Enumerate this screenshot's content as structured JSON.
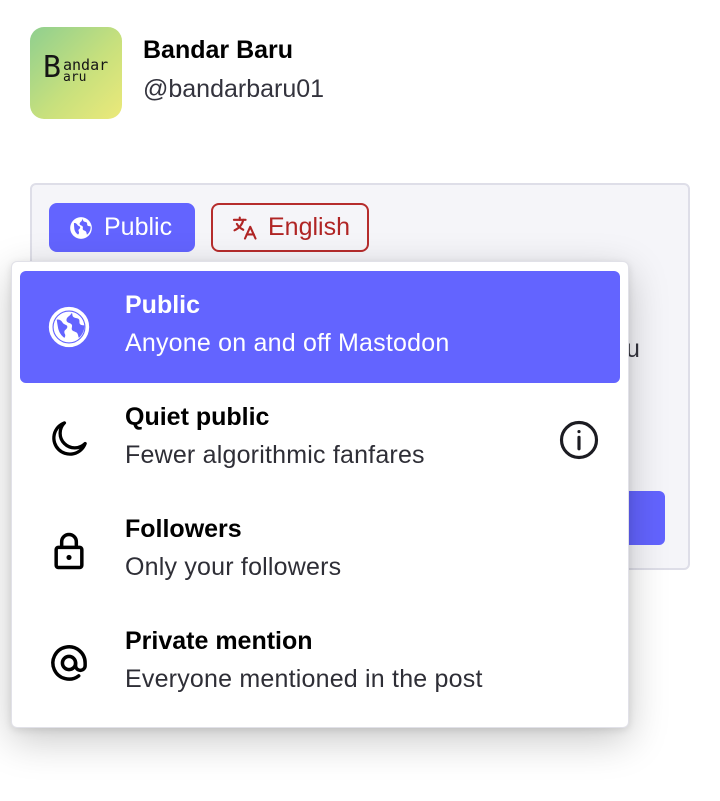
{
  "profile": {
    "display_name": "Bandar Baru",
    "handle": "@bandarbaru01",
    "avatar_text": {
      "big_letter": "B",
      "line1": "andar",
      "line2": "aru"
    }
  },
  "compose": {
    "visibility_chip_label": "Public",
    "language_chip_label": "English",
    "peek_text": "u"
  },
  "visibility_dropdown": {
    "options": [
      {
        "title": "Public",
        "description": "Anyone on and off Mastodon",
        "icon": "globe-icon",
        "selected": true
      },
      {
        "title": "Quiet public",
        "description": "Fewer algorithmic fanfares",
        "icon": "moon-icon",
        "selected": false,
        "has_info": true
      },
      {
        "title": "Followers",
        "description": "Only your followers",
        "icon": "lock-icon",
        "selected": false
      },
      {
        "title": "Private mention",
        "description": "Everyone mentioned in the post",
        "icon": "at-sign-icon",
        "selected": false
      }
    ]
  },
  "colors": {
    "accent": "#6364ff",
    "language_chip": "#b62d2d",
    "compose_bg": "#f5f5f9"
  }
}
